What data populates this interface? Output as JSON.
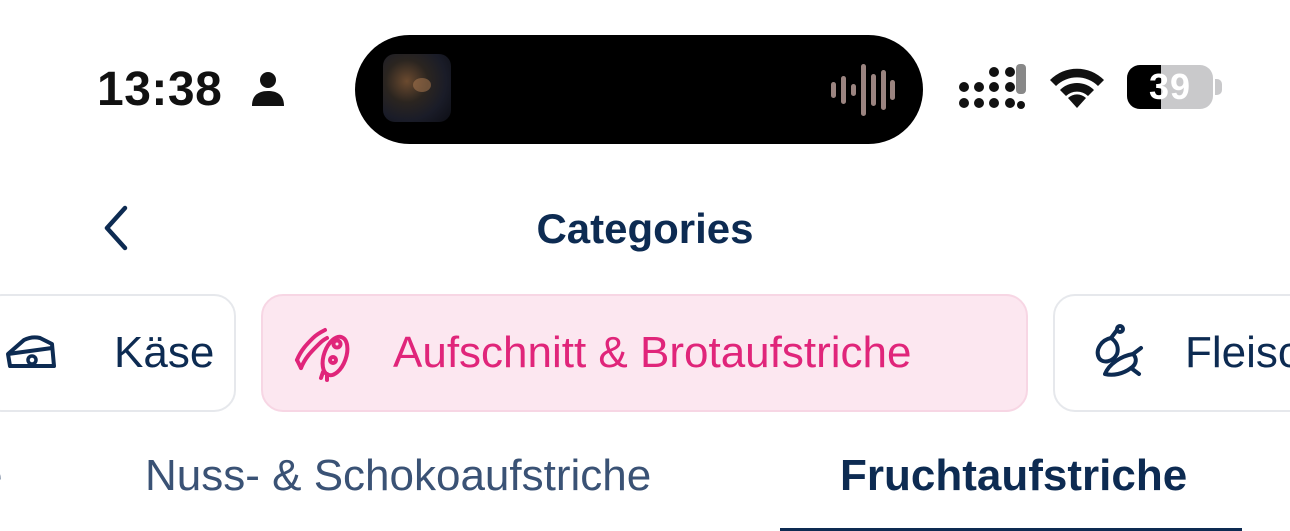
{
  "status_bar": {
    "time": "13:38",
    "battery_level": "39",
    "battery_fraction": 0.39,
    "icons": [
      "person-icon",
      "signal-icon",
      "wifi-icon",
      "battery-icon"
    ]
  },
  "now_playing": {
    "icons": [
      "album-art",
      "waveform-icon"
    ]
  },
  "nav": {
    "back_icon": "chevron-left-icon",
    "title": "Categories"
  },
  "category_chips": [
    {
      "label": "Käse",
      "icon": "cheese-icon",
      "selected": false
    },
    {
      "label": "Aufschnitt & Brotaufstriche",
      "icon": "cold-cuts-icon",
      "selected": true
    },
    {
      "label": "Fleisch",
      "icon": "meat-fish-icon",
      "selected": false
    }
  ],
  "subcategory_tabs": [
    {
      "label": "e",
      "selected": false
    },
    {
      "label": "Nuss- & Schokoaufstriche",
      "selected": false
    },
    {
      "label": "Fruchtaufstriche",
      "selected": true
    }
  ],
  "colors": {
    "primary_text": "#0d2b52",
    "accent_pink": "#e0257a",
    "selected_chip_bg": "#fce7f0",
    "chip_border": "#e6e8ec"
  }
}
